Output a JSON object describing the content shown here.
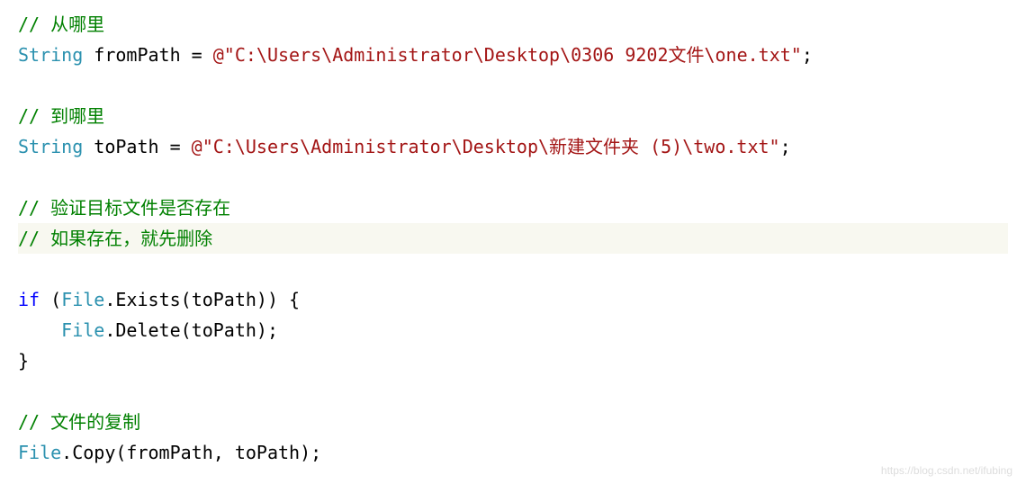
{
  "code": {
    "l1_comment": "// 从哪里",
    "l2_type": "String",
    "l2_var": " fromPath = ",
    "l2_at": "@",
    "l2_str": "\"C:\\Users\\Administrator\\Desktop\\0306 9202文件\\one.txt\"",
    "l2_semi": ";",
    "l3": " ",
    "l4_comment": "// 到哪里",
    "l5_type": "String",
    "l5_var": " toPath = ",
    "l5_at": "@",
    "l5_str": "\"C:\\Users\\Administrator\\Desktop\\新建文件夹 (5)\\two.txt\"",
    "l5_semi": ";",
    "l6": " ",
    "l7_comment": "// 验证目标文件是否存在",
    "l8_comment": "// 如果存在，就先删除",
    "l9_if": "if",
    "l9_open": " (",
    "l9_file": "File",
    "l9_exists": ".Exists(toPath)) {",
    "l10_indent": "    ",
    "l10_file": "File",
    "l10_delete": ".Delete(toPath);",
    "l11": "}",
    "l12": " ",
    "l13_comment": "// 文件的复制",
    "l14_file": "File",
    "l14_copy": ".Copy(fromPath, toPath);"
  },
  "watermark": "https://blog.csdn.net/ifubing"
}
